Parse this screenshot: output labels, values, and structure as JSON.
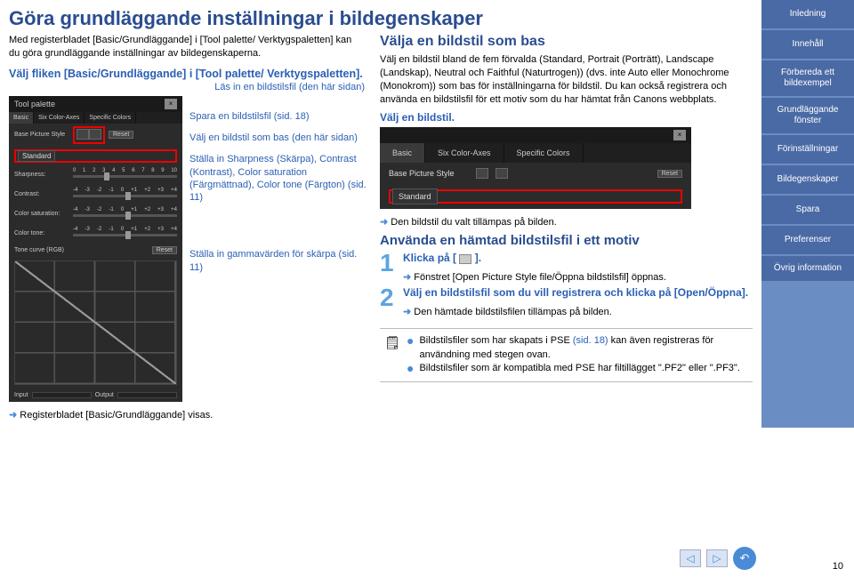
{
  "title": "Göra grundläggande inställningar i bildegenskaper",
  "intro": "Med registerbladet [Basic/Grundläggande] i [Tool palette/ Verktygspaletten] kan du göra grundläggande inställningar av bildegenskaperna.",
  "step1": "Välj fliken [Basic/Grundläggande] i [Tool palette/ Verktygspaletten].",
  "read_style": "Läs in en bildstilsfil (den här sidan)",
  "register_note": "Registerbladet [Basic/Grundläggande] visas.",
  "annot": {
    "save": "Spara en bildstilsfil (sid. 18)",
    "select_base": "Välj en bildstil som bas (den här sidan)",
    "sharpness": "Ställa in Sharpness (Skärpa), Contrast (Kontrast), Color saturation (Färgmättnad), Color tone (Färgton) (sid. 11)",
    "gamma": "Ställa in gammavärden för skärpa (sid. 11)"
  },
  "right": {
    "h2": "Välja en bildstil som bas",
    "body": "Välj en bildstil bland de fem förvalda (Standard, Portrait (Porträtt), Landscape (Landskap), Neutral och Faithful (Naturtrogen)) (dvs. inte Auto eller Monochrome (Monokrom)) som bas för inställningarna för bildstil. Du kan också registrera och använda en bildstilsfil för ett motiv som du har hämtat från Canons webbplats.",
    "select_style": "Välj en bildstil.",
    "applied": "Den bildstil du valt tillämpas på bilden.",
    "h3": "Använda en hämtad bildstilsfil i ett motiv",
    "step1": "Klicka på [",
    "step1b": "].",
    "step1_note": "Fönstret [Open Picture Style file/Öppna bildstilsfil] öppnas.",
    "step2": "Välj en bildstilsfil som du vill registrera och klicka på [Open/Öppna].",
    "step2_note": "Den hämtade bildstilsfilen tillämpas på bilden."
  },
  "panel": {
    "title": "Tool palette",
    "tabs": [
      "Basic",
      "Six Color-Axes",
      "Specific Colors"
    ],
    "base_label": "Base Picture Style",
    "reset": "Reset",
    "style_value": "Standard",
    "sharpness": "Sharpness:",
    "contrast": "Contrast:",
    "color_sat": "Color saturation:",
    "color_tone": "Color tone:",
    "tone_curve": "Tone curve (RGB)",
    "input": "Input",
    "output": "Output"
  },
  "tip": {
    "line1a": "Bildstilsfiler som har skapats i PSE ",
    "line1_link": "(sid. 18)",
    "line1b": " kan även registreras för användning med stegen ovan.",
    "line2": "Bildstilsfiler som är kompatibla med PSE har filtillägget \".PF2\" eller \".PF3\"."
  },
  "nav": {
    "items": [
      "Inledning",
      "Innehåll",
      "Förbereda ett bildexempel",
      "Grundläggande fönster",
      "Förinställningar",
      "Bildegenskaper",
      "Spara",
      "Preferenser",
      "Övrig information"
    ]
  },
  "page_number": "10"
}
